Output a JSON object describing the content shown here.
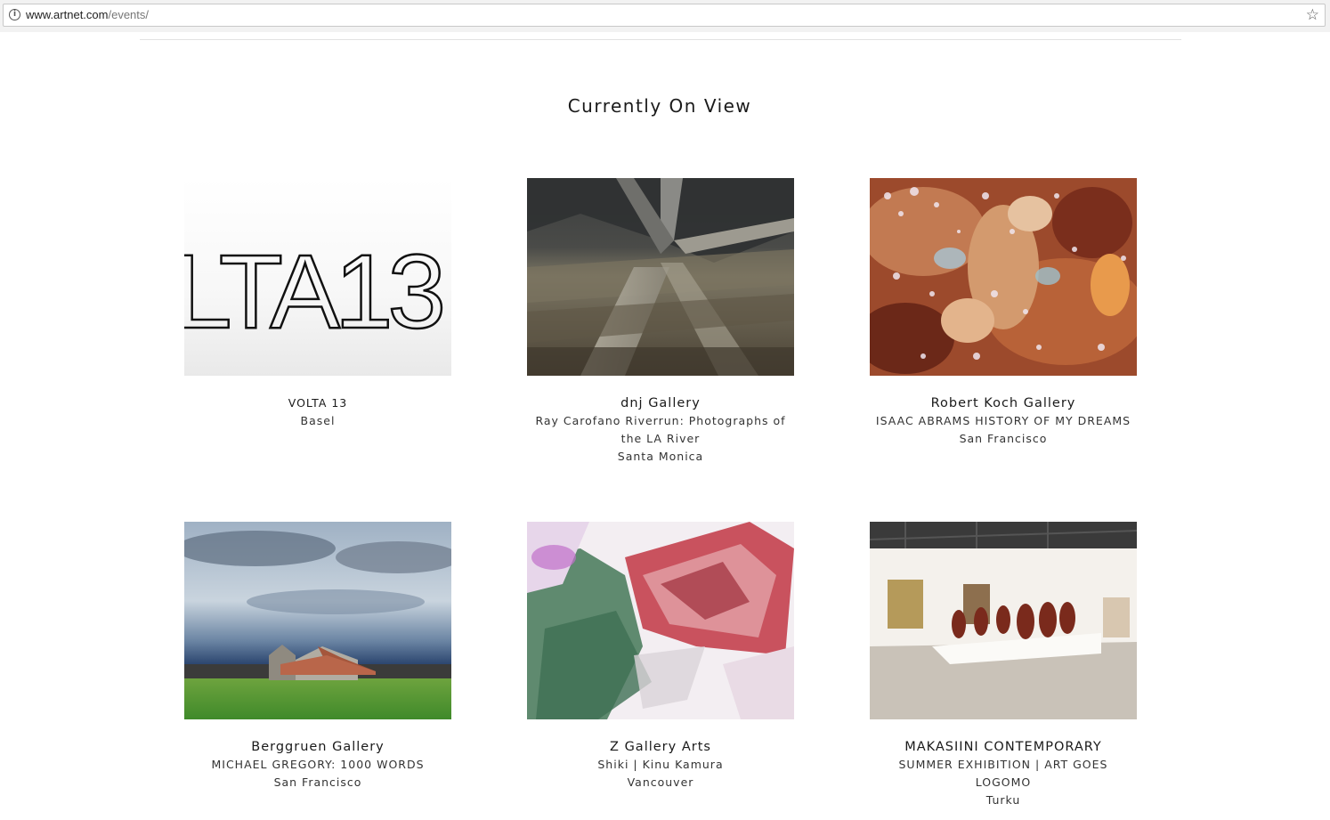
{
  "browser": {
    "url_host": "www.artnet.com",
    "url_path": "/events/",
    "info_icon": "info-icon",
    "star_icon": "star-icon"
  },
  "section": {
    "title": "Currently On View"
  },
  "cards": [
    {
      "name": "VOLTA 13",
      "subtitle": "",
      "city": "Basel"
    },
    {
      "name": "dnj Gallery",
      "subtitle": "Ray Carofano Riverrun: Photographs of the LA River",
      "city": "Santa Monica"
    },
    {
      "name": "Robert Koch Gallery",
      "subtitle": "ISAAC ABRAMS HISTORY OF MY DREAMS",
      "city": "San Francisco"
    },
    {
      "name": "Berggruen Gallery",
      "subtitle": "MICHAEL GREGORY: 1000 WORDS",
      "city": "San Francisco"
    },
    {
      "name": "Z Gallery Arts",
      "subtitle": "Shiki | Kinu Kamura",
      "city": "Vancouver"
    },
    {
      "name": "MAKASIINI CONTEMPORARY",
      "subtitle": "SUMMER EXHIBITION | ART GOES LOGOMO",
      "city": "Turku"
    }
  ],
  "thumb_text": {
    "volta": "LTA13"
  }
}
